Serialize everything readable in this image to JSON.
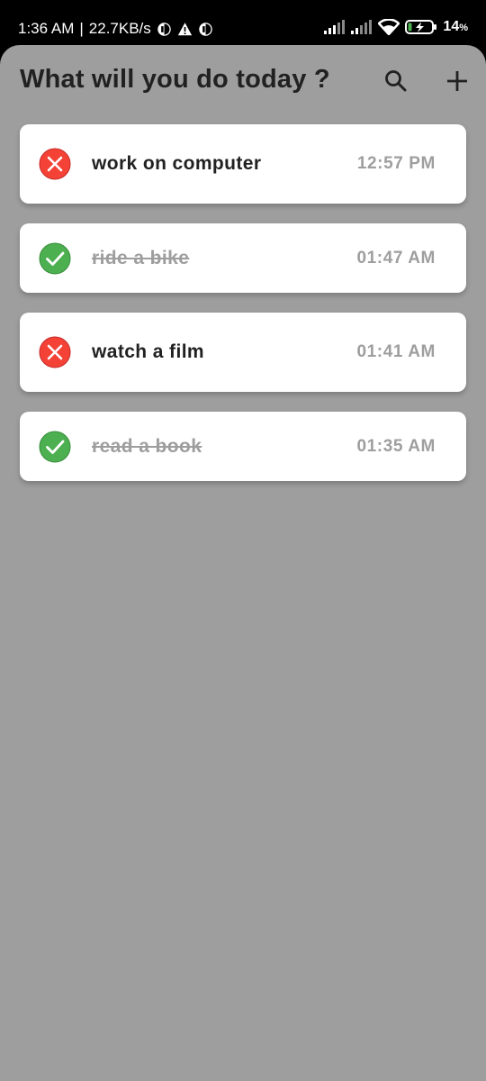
{
  "status_bar": {
    "time": "1:36 AM",
    "separator": "|",
    "speed": "22.7KB/s",
    "battery_value": "14",
    "battery_unit": "%"
  },
  "header": {
    "title": "What will you do today ?",
    "search_icon": "search-icon",
    "add_icon": "plus-icon"
  },
  "colors": {
    "background": "#9e9e9e",
    "done": "#4caf50",
    "pending": "#f44336"
  },
  "tasks": [
    {
      "title": "work on computer",
      "time": "12:57 PM",
      "done": false,
      "icon": "cancel-icon"
    },
    {
      "title": "ride a bike",
      "time": "01:47 AM",
      "done": true,
      "icon": "check-circle-icon"
    },
    {
      "title": "watch a film",
      "time": "01:41 AM",
      "done": false,
      "icon": "cancel-icon"
    },
    {
      "title": "read a book",
      "time": "01:35 AM",
      "done": true,
      "icon": "check-circle-icon"
    }
  ]
}
